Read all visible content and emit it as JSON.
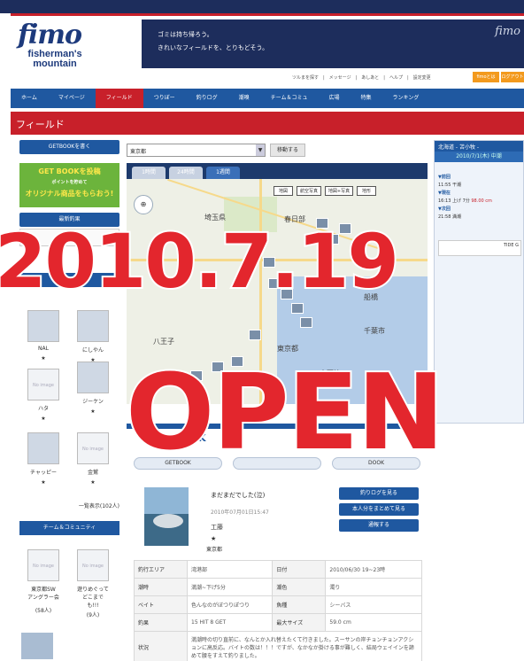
{
  "header": {
    "logo_script": "fimo",
    "logo_sub_1": "fisherman's",
    "logo_sub_2": "mountain",
    "banner_line1": "ゴミは持ち帰ろう。",
    "banner_line2": "きれいなフィールドを、とりもどそう。",
    "banner_logo": "fimo",
    "top_links": "ツルまを探す　|　メッセージ　|　あしあと　|　ヘルプ　|　設定変更",
    "orange_btn_1": "fimoとは",
    "orange_btn_2": "ログアウト"
  },
  "nav": {
    "items": [
      "ホーム",
      "マイページ",
      "フィールド",
      "つりぼー",
      "釣りログ",
      "潮嗅",
      "チーム＆コミュ",
      "広場",
      "特集",
      "ランキング"
    ]
  },
  "page_title": "フィールド",
  "sidebar": {
    "getbook_button": "GETBOOKを書く",
    "green_line1": "GET BOOKを投稿",
    "green_line2": "ポイントを貯めて",
    "green_line3": "オリジナル商品をもらおう!",
    "latest_catch": "最新釣果",
    "search_placeholder": "シー",
    "search_go": "検索",
    "ranking_head": "釣りアー",
    "users": [
      {
        "name": "NAL",
        "star": "★",
        "noimg": ""
      },
      {
        "name": "にしやん",
        "star": "★",
        "noimg": ""
      },
      {
        "name": "ハタ",
        "star": "★",
        "noimg": "No image"
      },
      {
        "name": "ジーケン",
        "star": "★",
        "noimg": ""
      },
      {
        "name": "チャッピー",
        "star": "★",
        "noimg": ""
      },
      {
        "name": "金鷲",
        "star": "★",
        "noimg": "No image"
      }
    ],
    "more_link": "一覧表示(102人)",
    "team_head": "チーム＆コミュニティ",
    "teams": [
      {
        "noimg": "No image",
        "name": "東京都SW\nアングラー会",
        "count": "(58人)"
      },
      {
        "noimg": "No image",
        "name": "遊りめぐって\nどこまで\nも!!!",
        "count": "(9人)"
      }
    ]
  },
  "map": {
    "city_value": "東京都",
    "move_button": "移動する",
    "tabs": [
      "1時間",
      "24時間",
      "1週間"
    ],
    "active_tab": 2,
    "map_types": [
      "地図",
      "航空写真",
      "地図+写真",
      "地形"
    ],
    "labels": [
      "埼玉県",
      "春日部",
      "船橋",
      "東京都",
      "千葉市",
      "木更津",
      "八王子"
    ]
  },
  "tide": {
    "head": "北海道 - 苫小牧 -",
    "date": "2010/7/1(木) 中潮",
    "rows": [
      {
        "label": "▼前回",
        "text": "11:55 干潮"
      },
      {
        "label": "▼現在",
        "text": "16:13 上げ 7分"
      },
      {
        "label": "▼次回",
        "text": "21:58 満潮"
      }
    ],
    "height": "98.00 cm",
    "chart_label": "TIDE G"
  },
  "detail": {
    "header": "GETBOOK",
    "pills": [
      "GETBOOK",
      "",
      "DOOK"
    ],
    "title": "まだまだでした(泣)",
    "time": "2010年07月01日15:47",
    "user": "工藤",
    "star": "★",
    "location": "東京都",
    "buttons": [
      "釣りログを見る",
      "本人分をまとめて見る",
      "通報する"
    ],
    "rows": [
      {
        "k1": "釣行エリア",
        "v1": "湾港部",
        "k2": "日付",
        "v2": "2010/06/30 19~23時"
      },
      {
        "k1": "潮時",
        "v1": "満潮~下げ5分",
        "k2": "潮色",
        "v2": "濁り"
      },
      {
        "k1": "ベイト",
        "v1": "色んなのがぼつりぽつり",
        "k2": "魚種",
        "v2": "シーバス"
      },
      {
        "k1": "釣果",
        "v1": "15 HIT 8 GET",
        "k2": "最大サイズ",
        "v2": "59.0 cm"
      },
      {
        "k1": "状況",
        "v1": "満潮時の切り直前に、なんとか入れ替えたくて行きました。スーサンの岸チョンチョンアクションに高反応。バイトの数は！！！ですが、なかなか掛ける事が難しく、結局ウェイインを諦めて腰をすえて釣りました。"
      }
    ]
  },
  "stamp": {
    "date": "2010.7.19",
    "open": "OPEN"
  }
}
